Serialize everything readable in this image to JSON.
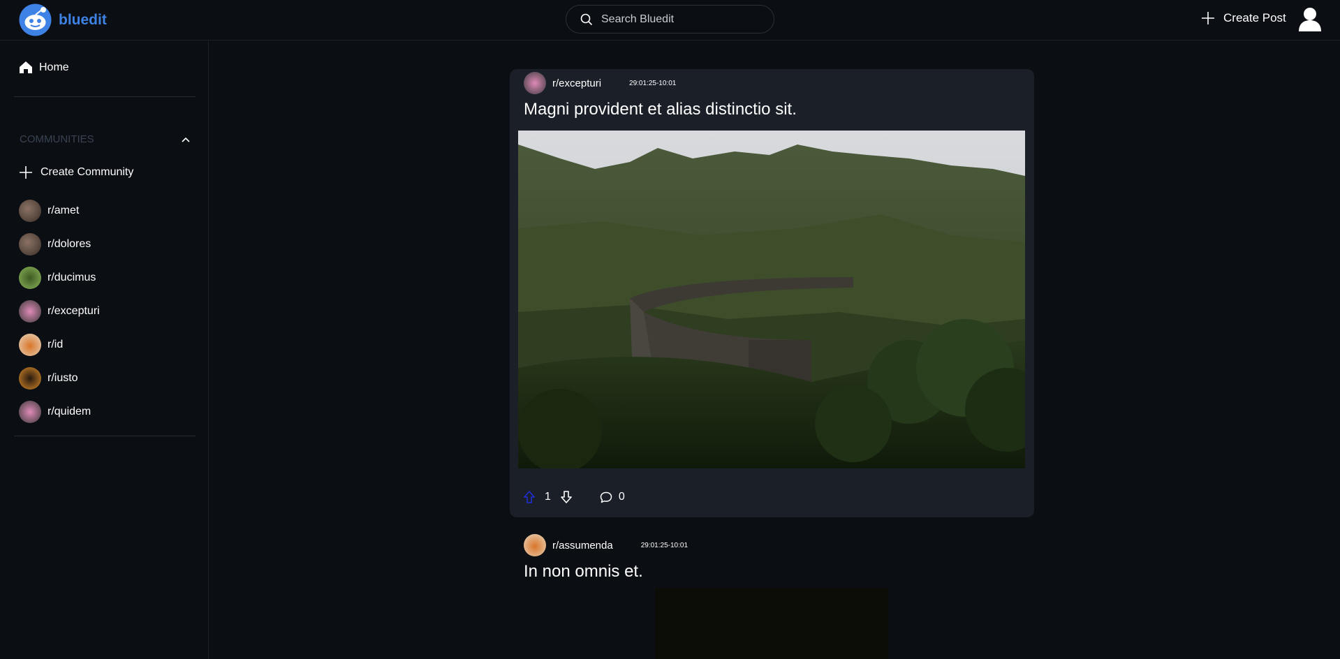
{
  "header": {
    "brand": "bluedit",
    "search_placeholder": "Search Bluedit",
    "create_post_label": "Create Post"
  },
  "sidebar": {
    "home_label": "Home",
    "communities_heading": "COMMUNITIES",
    "create_community_label": "Create Community",
    "communities": [
      {
        "label": "r/amet",
        "avatar_color": "#5a4a42"
      },
      {
        "label": "r/dolores",
        "avatar_color": "#574840"
      },
      {
        "label": "r/ducimus",
        "avatar_color": "#5c8a3a"
      },
      {
        "label": "r/excepturi",
        "avatar_color": "#c86a9a"
      },
      {
        "label": "r/id",
        "avatar_color": "#d99a5a"
      },
      {
        "label": "r/iusto",
        "avatar_color": "#c0772a"
      },
      {
        "label": "r/quidem",
        "avatar_color": "#c86a9a"
      }
    ]
  },
  "posts": [
    {
      "community": "r/excepturi",
      "time": "29:01:25-10:01",
      "title": "Magni provident et alias distinctio sit.",
      "score": "1",
      "comments": "0",
      "avatar_color": "#c86a9a"
    },
    {
      "community": "r/assumenda",
      "time": "29:01:25-10:01",
      "title": "In non omnis et.",
      "avatar_color": "#d99a5a"
    }
  ],
  "colors": {
    "background": "#0b0e13",
    "card": "#1a1f28",
    "brand": "#3e82e6",
    "upvote_active": "#1f2fd6"
  }
}
